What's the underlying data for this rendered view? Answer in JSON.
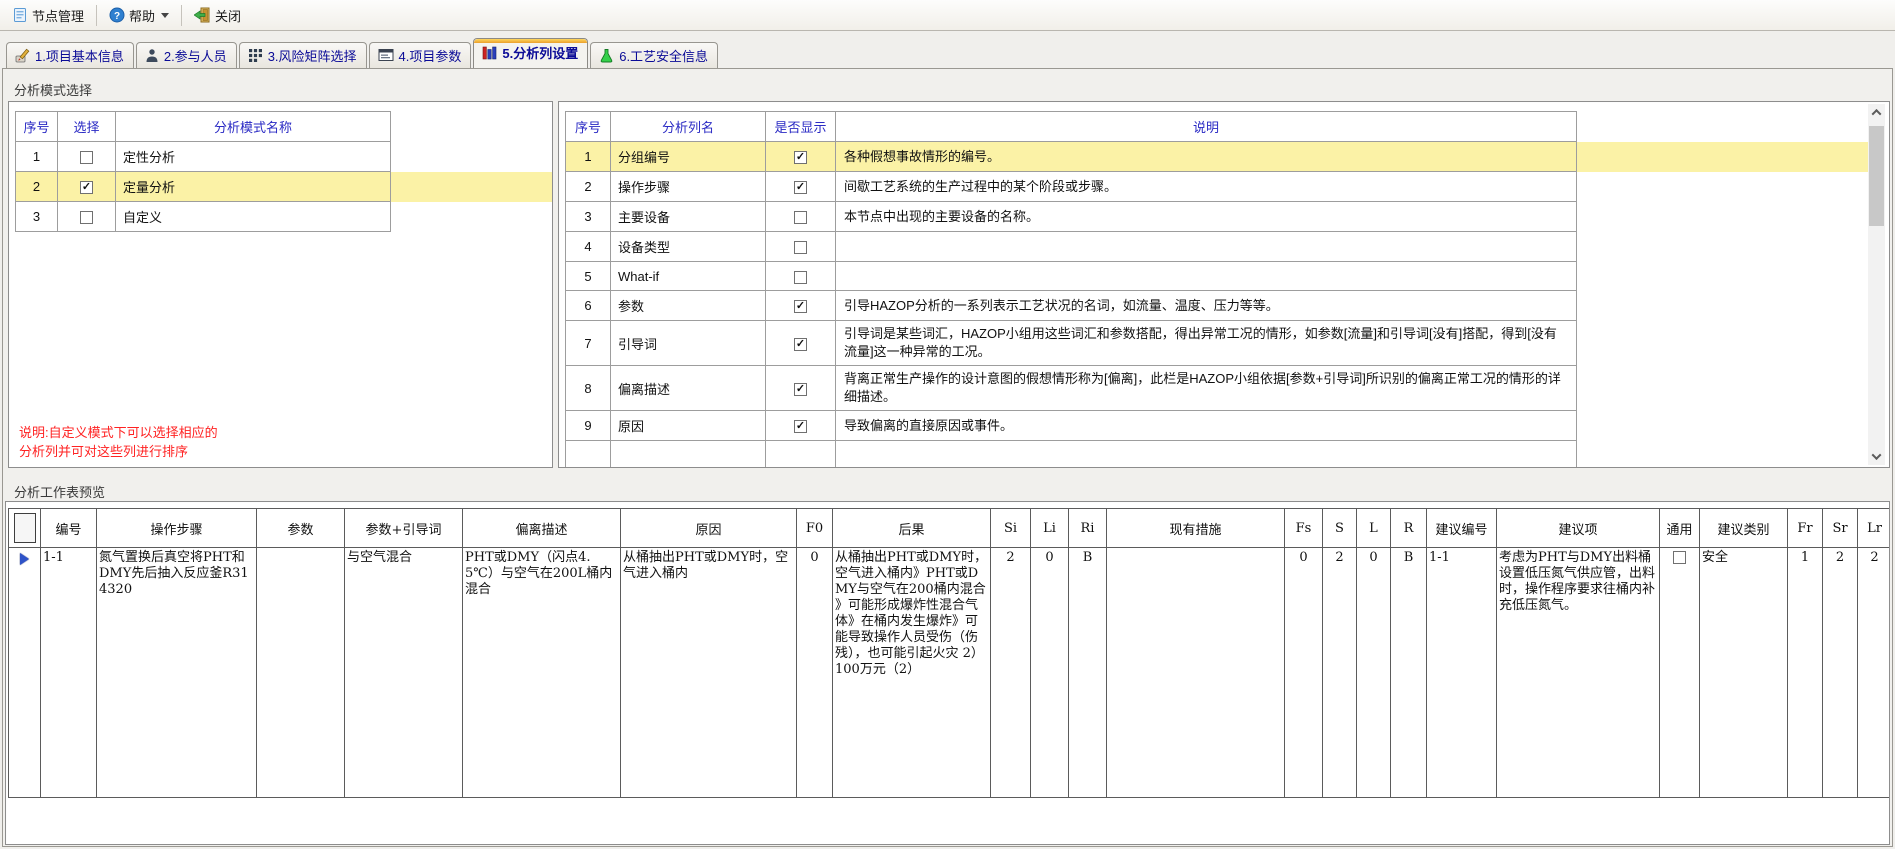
{
  "toolbar": {
    "node_manage": "节点管理",
    "help": "帮助",
    "close": "关闭"
  },
  "tabs": [
    {
      "label": "1.项目基本信息"
    },
    {
      "label": "2.参与人员"
    },
    {
      "label": "3.风险矩阵选择"
    },
    {
      "label": "4.项目参数"
    },
    {
      "label": "5.分析列设置"
    },
    {
      "label": "6.工艺安全信息"
    }
  ],
  "mode_section": {
    "title": "分析模式选择",
    "note_line1": "说明:自定义模式下可以选择相应的",
    "note_line2": "分析列并可对这些列进行排序",
    "mode_table": {
      "headers": [
        "序号",
        "选择",
        "分析模式名称"
      ],
      "rows": [
        {
          "index": "1",
          "checked": false,
          "name": "定性分析"
        },
        {
          "index": "2",
          "checked": true,
          "name": "定量分析"
        },
        {
          "index": "3",
          "checked": false,
          "name": "自定义"
        }
      ]
    },
    "columns_table": {
      "headers": [
        "序号",
        "分析列名",
        "是否显示",
        "说明"
      ],
      "rows": [
        {
          "index": "1",
          "name": "分组编号",
          "checked": true,
          "desc": "各种假想事故情形的编号。"
        },
        {
          "index": "2",
          "name": "操作步骤",
          "checked": true,
          "desc": "间歇工艺系统的生产过程中的某个阶段或步骤。"
        },
        {
          "index": "3",
          "name": "主要设备",
          "checked": false,
          "desc": "本节点中出现的主要设备的名称。"
        },
        {
          "index": "4",
          "name": "设备类型",
          "checked": false,
          "desc": ""
        },
        {
          "index": "5",
          "name": "What-if",
          "checked": false,
          "desc": ""
        },
        {
          "index": "6",
          "name": "参数",
          "checked": true,
          "desc": "引导HAZOP分析的一系列表示工艺状况的名词，如流量、温度、压力等等。"
        },
        {
          "index": "7",
          "name": "引导词",
          "checked": true,
          "desc": "引导词是某些词汇，HAZOP小组用这些词汇和参数搭配，得出异常工况的情形，如参数[流量]和引导词[没有]搭配，得到[没有流量]这一种异常的工况。"
        },
        {
          "index": "8",
          "name": "偏离描述",
          "checked": true,
          "desc": "背离正常生产操作的设计意图的假想情形称为[偏离]，此栏是HAZOP小组依据[参数+引导词]所识别的偏离正常工况的情形的详细描述。"
        },
        {
          "index": "9",
          "name": "原因",
          "checked": true,
          "desc": "导致偏离的直接原因或事件。"
        }
      ]
    }
  },
  "worksheet": {
    "title": "分析工作表预览",
    "headers": [
      "编号",
      "操作步骤",
      "参数",
      "参数+引导词",
      "偏离描述",
      "原因",
      "F0",
      "后果",
      "Si",
      "Li",
      "Ri",
      "现有措施",
      "Fs",
      "S",
      "L",
      "R",
      "建议编号",
      "建议项",
      "通用",
      "建议类别",
      "Fr",
      "Sr",
      "Lr"
    ],
    "row": {
      "id": "1-1",
      "step": "氮气置换后真空将PHT和DMY先后抽入反应釜R314320",
      "param": "",
      "param_guide": "与空气混合",
      "deviation": "PHT或DMY（闪点4.5℃）与空气在200L桶内混合",
      "cause": "从桶抽出PHT或DMY时，空气进入桶内",
      "f0": "0",
      "consequence": "从桶抽出PHT或DMY时，空气进入桶内》PHT或DMY与空气在200桶内混合 》可能形成爆炸性混合气体》在桶内发生爆炸》可能导致操作人员受伤（伤残），也可能引起火灾 2） 100万元（2）",
      "si": "2",
      "li": "0",
      "ri": "B",
      "measures": "",
      "fs": "0",
      "s": "2",
      "l": "0",
      "r": "B",
      "rec_id": "1-1",
      "recommendation": "考虑为PHT与DMY出料桶设置低压氮气供应管，出料时，操作程序要求往桶内补充低压氮气。",
      "common_checked": false,
      "rec_type": "安全",
      "fr": "1",
      "sr": "2",
      "lr": "2"
    }
  },
  "colors": {
    "accent_tab": "#eb9f2c",
    "selected_row": "#fbf2a6",
    "note_red": "#ff2222",
    "header_blue": "#2a2ac4"
  }
}
